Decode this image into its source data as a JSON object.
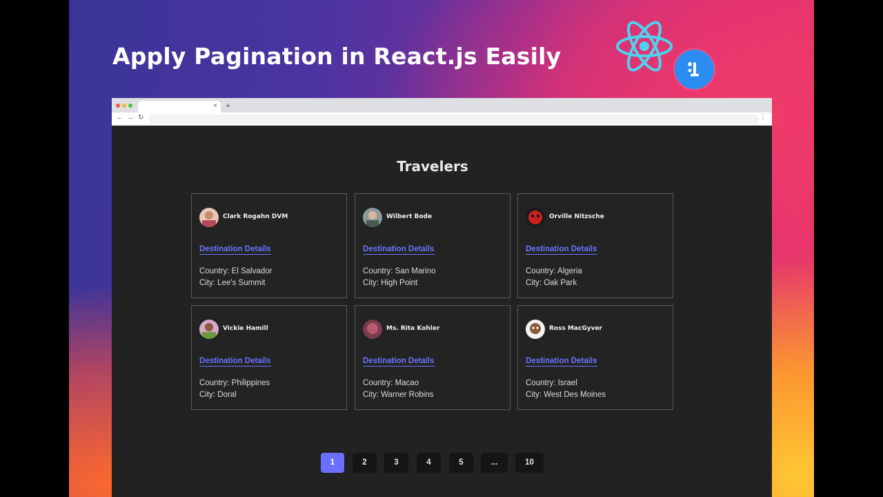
{
  "video": {
    "headline": "Apply Pagination in React.js Easily"
  },
  "icons": {
    "react": "react-atom-icon",
    "badge": "brand-badge-icon"
  },
  "colors": {
    "react_cyan": "#4fd2ee",
    "badge_blue": "#2b8cf2",
    "link": "#6b74ff",
    "active_page": "#6a6fff",
    "page_bg": "#222222"
  },
  "browser": {
    "tab_close": "×",
    "new_tab": "+",
    "back": "←",
    "forward": "→",
    "reload": "↻",
    "menu": "⋮"
  },
  "page": {
    "title": "Travelers",
    "travelers": [
      {
        "name": "Clark Rogahn DVM",
        "link": "Destination Details",
        "country": "Country: El Salvador",
        "city": "City: Lee's Summit"
      },
      {
        "name": "Wilbert Bode",
        "link": "Destination Details",
        "country": "Country: San Marino",
        "city": "City: High Point"
      },
      {
        "name": "Orville Nitzsche",
        "link": "Destination Details",
        "country": "Country: Algeria",
        "city": "City: Oak Park"
      },
      {
        "name": "Vickie Hamill",
        "link": "Destination Details",
        "country": "Country: Philippines",
        "city": "City: Doral"
      },
      {
        "name": "Ms. Rita Kohler",
        "link": "Destination Details",
        "country": "Country: Macao",
        "city": "City: Warner Robins"
      },
      {
        "name": "Ross MacGyver",
        "link": "Destination Details",
        "country": "Country: Israel",
        "city": "City: West Des Moines"
      }
    ],
    "pagination": {
      "pages": [
        "1",
        "2",
        "3",
        "4",
        "5",
        "...",
        "10"
      ],
      "active": "1"
    }
  }
}
